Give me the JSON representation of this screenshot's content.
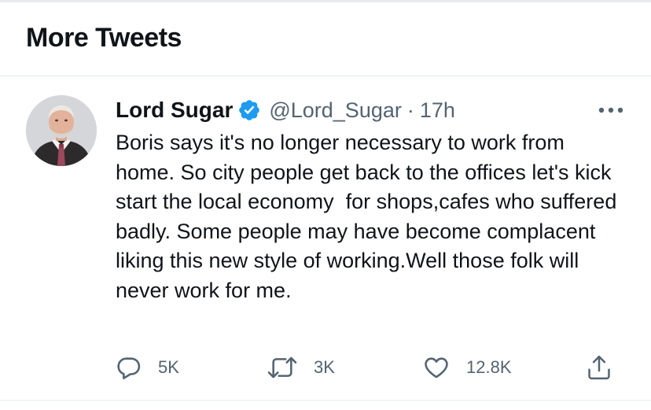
{
  "section": {
    "title": "More Tweets"
  },
  "tweet": {
    "author": {
      "display_name": "Lord Sugar",
      "handle": "@Lord_Sugar",
      "verified": true,
      "avatar_icon": "profile-photo"
    },
    "separator": "·",
    "timestamp": "17h",
    "more_icon": "more-options-icon",
    "text": "Boris says it's no longer necessary to work from home. So city people get back to the offices let's kick start the local economy  for shops,cafes who suffered badly. Some people may have become complacent liking this new style of working.Well those folk will never work for me.",
    "actions": {
      "reply": {
        "icon": "reply-icon",
        "count": "5K"
      },
      "retweet": {
        "icon": "retweet-icon",
        "count": "3K"
      },
      "like": {
        "icon": "heart-icon",
        "count": "12.8K"
      },
      "share": {
        "icon": "share-icon"
      }
    }
  },
  "colors": {
    "text_primary": "#0f1419",
    "text_secondary": "#536471",
    "verified_badge": "#1d9bf0",
    "divider": "#e6ecf0"
  }
}
